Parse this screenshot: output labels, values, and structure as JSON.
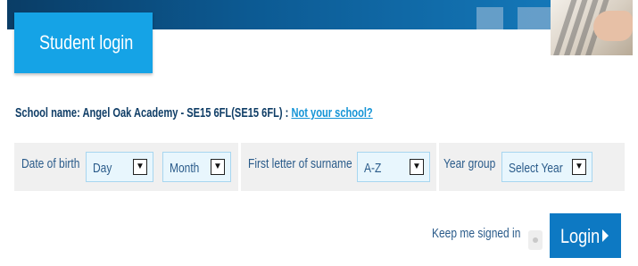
{
  "header": {
    "tab_title": "Student login"
  },
  "school": {
    "prefix": "School name: Angel Oak Academy - SE15 6FL(SE15 6FL) : ",
    "change_link": "Not your school?"
  },
  "form": {
    "dob_label": "Date of birth",
    "day_value": "Day",
    "month_value": "Month",
    "surname_label": "First letter of surname",
    "surname_value": "A-Z",
    "year_label": "Year group",
    "year_value": "Select Year"
  },
  "footer": {
    "keep_label": "Keep me signed in",
    "login_label": "Login"
  },
  "icons": {
    "dropdown": "chevron-down-icon",
    "login": "chevron-right-icon"
  },
  "colors": {
    "accent": "#15a3e6",
    "login_button": "#0d79c3",
    "banner": "#0c5a93",
    "text": "#2a5b8a",
    "link": "#1494d6"
  }
}
